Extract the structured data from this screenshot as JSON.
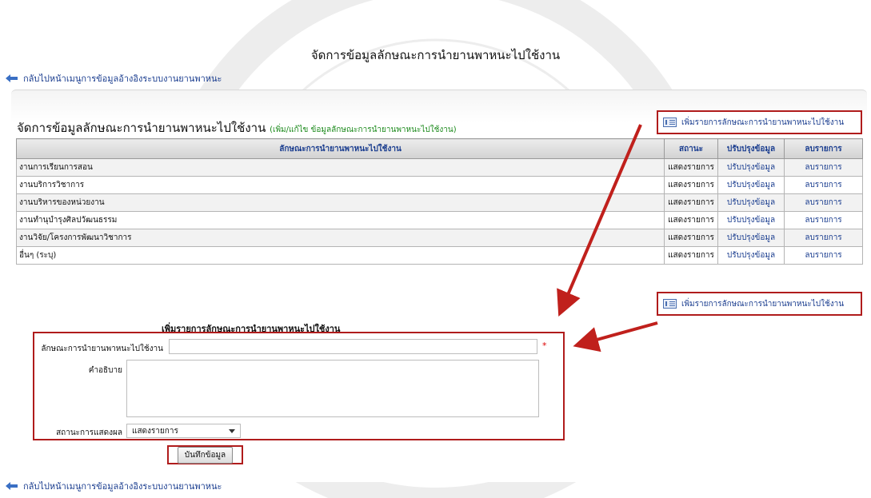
{
  "page": {
    "title": "จัดการข้อมูลลักษณะการนำยานพาหนะไปใช้งาน"
  },
  "nav": {
    "back_label": "กลับไปหน้าเมนูการข้อมูลอ้างอิงระบบงานยานพาหนะ"
  },
  "section": {
    "title": "จัดการข้อมูลลักษณะการนำยานพาหนะไปใช้งาน",
    "subtitle": "(เพิ่ม/แก้ไข ข้อมูลลักษณะการนำยานพาหนะไปใช้งาน)",
    "add_label": "เพิ่มรายการลักษณะการนำยานพาหนะไปใช้งาน"
  },
  "table": {
    "headers": [
      "ลักษณะการนำยานพาหนะไปใช้งาน",
      "สถานะ",
      "ปรับปรุงข้อมูล",
      "ลบรายการ"
    ],
    "rows": [
      {
        "name": "งานการเรียนการสอน",
        "status": "แสดงรายการ",
        "edit": "ปรับปรุงข้อมูล",
        "delete": "ลบรายการ"
      },
      {
        "name": "งานบริการวิชาการ",
        "status": "แสดงรายการ",
        "edit": "ปรับปรุงข้อมูล",
        "delete": "ลบรายการ"
      },
      {
        "name": "งานบริหารของหน่วยงาน",
        "status": "แสดงรายการ",
        "edit": "ปรับปรุงข้อมูล",
        "delete": "ลบรายการ"
      },
      {
        "name": "งานทำนุบำรุงศิลปวัฒนธรรม",
        "status": "แสดงรายการ",
        "edit": "ปรับปรุงข้อมูล",
        "delete": "ลบรายการ"
      },
      {
        "name": "งานวิจัย/โครงการพัฒนาวิชาการ",
        "status": "แสดงรายการ",
        "edit": "ปรับปรุงข้อมูล",
        "delete": "ลบรายการ"
      },
      {
        "name": "อื่นๆ (ระบุ)",
        "status": "แสดงรายการ",
        "edit": "ปรับปรุงข้อมูล",
        "delete": "ลบรายการ"
      }
    ]
  },
  "form": {
    "title": "เพิ่มรายการลักษณะการนำยานพาหนะไปใช้งาน",
    "name_label": "ลักษณะการนำยานพาหนะไปใช้งาน",
    "name_value": "",
    "required_mark": "*",
    "desc_label": "คำอธิบาย",
    "desc_value": "",
    "status_label": "สถานะการแสดงผล",
    "status_selected": "แสดงรายการ",
    "save_label": "บันทึกข้อมูล"
  },
  "colors": {
    "link": "#1a3d8f",
    "highlight_border": "#b01c1c",
    "subtitle": "#1c8a1c",
    "required": "#dd0000"
  },
  "icons": {
    "back": "back-arrow-icon",
    "add": "list-add-icon",
    "annotation": "red-arrow"
  }
}
